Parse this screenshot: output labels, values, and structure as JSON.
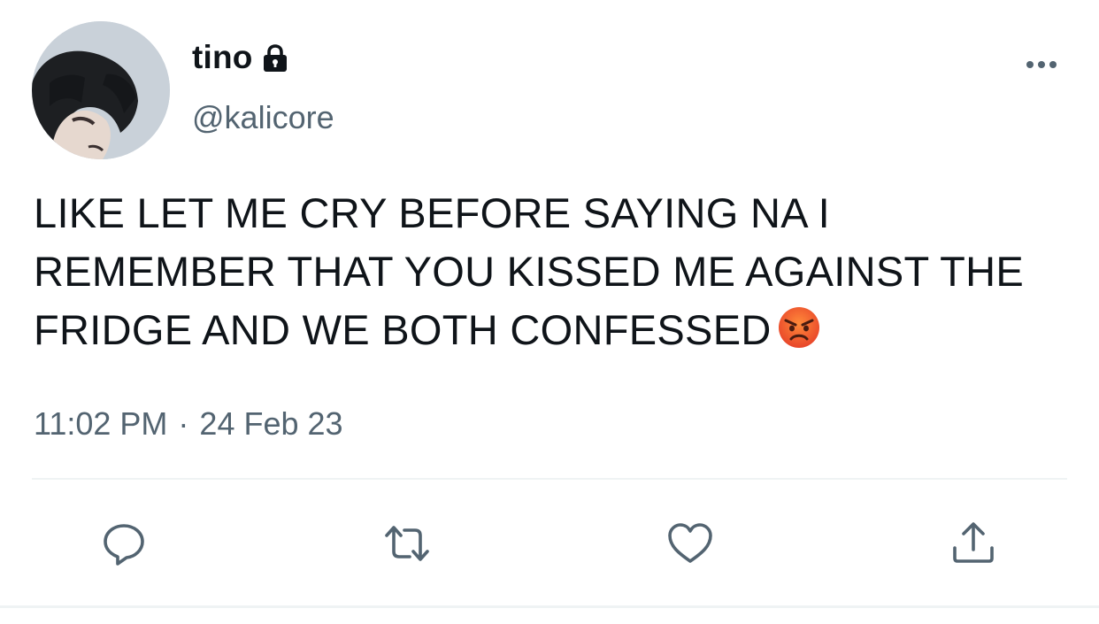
{
  "user": {
    "display_name": "tino",
    "handle": "@kalicore",
    "protected_icon": "lock-icon",
    "avatar_icon": "avatar-photo"
  },
  "tweet": {
    "text": "LIKE LET ME CRY BEFORE SAYING NA I REMEMBER THAT YOU KISSED ME AGAINST THE FRIDGE AND WE BOTH CONFESSED",
    "emoji": "😡",
    "time": "11:02 PM",
    "separator": "·",
    "date": "24 Feb 23"
  },
  "actions": [
    {
      "name": "reply",
      "icon": "reply-icon"
    },
    {
      "name": "retweet",
      "icon": "retweet-icon"
    },
    {
      "name": "like",
      "icon": "heart-icon"
    },
    {
      "name": "share",
      "icon": "share-icon"
    }
  ],
  "menu": {
    "icon": "more-icon"
  },
  "colors": {
    "text": "#0f1419",
    "secondary": "#536471",
    "divider": "#eff3f4",
    "action_icon": "#536471"
  }
}
